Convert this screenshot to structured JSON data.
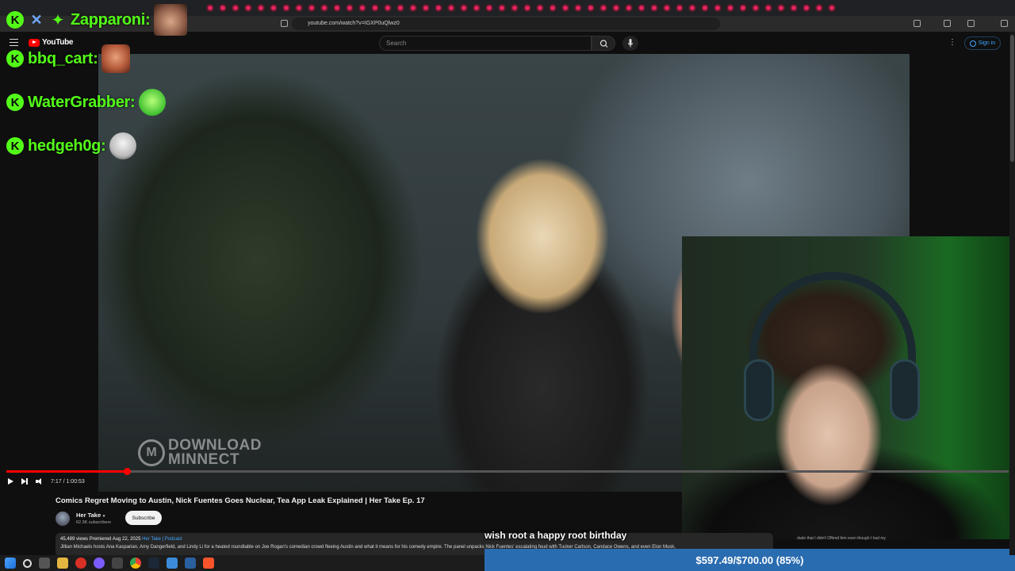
{
  "browser": {
    "url": "youtube.com/watch?v=IGXP0uQlwz0"
  },
  "youtube": {
    "logo_text": "YouTube",
    "search_placeholder": "Search",
    "signin_label": "Sign in"
  },
  "player": {
    "time": "7:17 / 1:00:53",
    "progress_fraction": 0.12
  },
  "video": {
    "title": "Comics Regret Moving to Austin, Nick Fuentes Goes Nuclear, Tea App Leak Explained | Her Take Ep. 17",
    "channel": "Her Take",
    "subscribers": "62.3K subscribers",
    "subscribe_label": "Subscribe",
    "views": "45,489 views",
    "premiered": "Premiered Aug 22, 2025",
    "tags": "Her Take | Podcast",
    "description": "Jillian Michaels hosts Ana Kasparian, Amy Dangerfield, and Lindy Li for a heated roundtable on Joe Rogan's comedian crowd fleeing Austin and what it means for his comedy empire. The panel unpacks Nick Fuentes' escalating feud with Tucker Carlson, Candace Owens, and even Elon Musk,"
  },
  "watermark": {
    "line1": "DOWNLOAD",
    "line2": "MINNECT"
  },
  "chat": [
    {
      "badge": "K",
      "username": "Zapparoni:",
      "emote": "face-emote"
    },
    {
      "badge": "K",
      "username": "bbq_cart:",
      "emote": "face-emote"
    },
    {
      "badge": "K",
      "username": "WaterGrabber:",
      "emote": "laughing-emote"
    },
    {
      "badge": "K",
      "username": "hedgeh0g:",
      "emote": "trollface-emote"
    }
  ],
  "overlay": {
    "caption": "wish root a happy root birthday",
    "donation_goal": "$597.49/$700.00 (85%)",
    "side_chat": "dude that I didn't Offend him even though I had my"
  },
  "colors": {
    "kick_green": "#53fc18",
    "youtube_red": "#ff0000",
    "donation_blue": "#2a6cb0",
    "link_blue": "#3ea6ff"
  }
}
